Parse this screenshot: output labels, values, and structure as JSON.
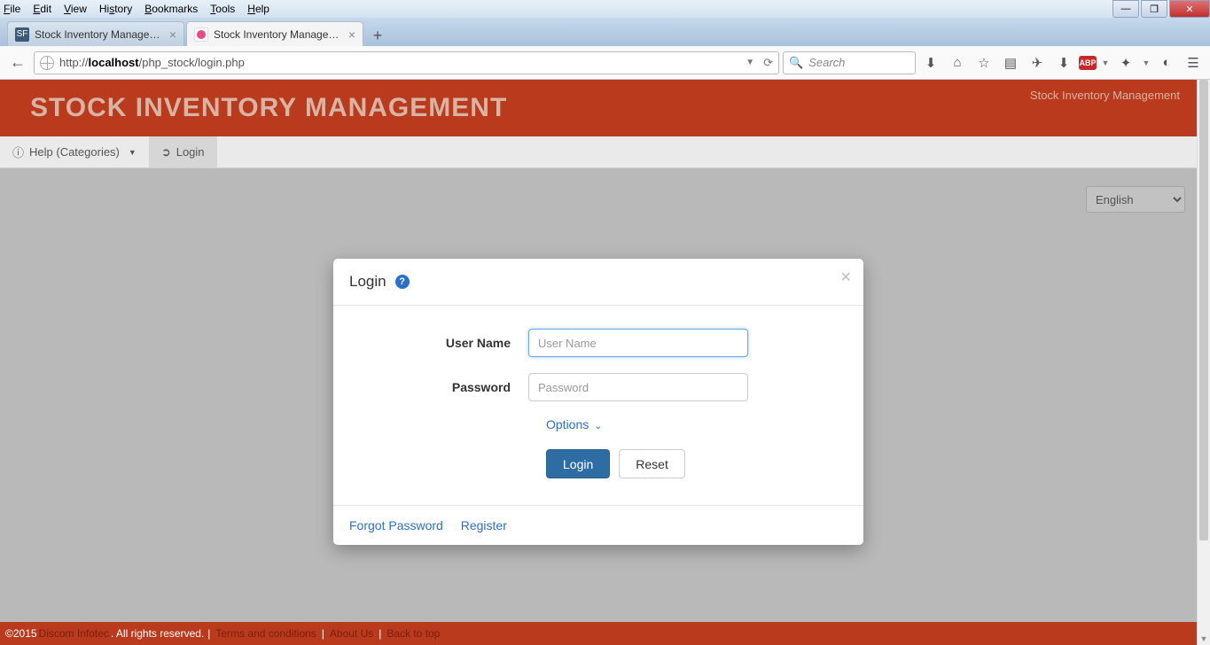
{
  "browser": {
    "menus": {
      "file": "File",
      "edit": "Edit",
      "view": "View",
      "history": "History",
      "bookmarks": "Bookmarks",
      "tools": "Tools",
      "help": "Help"
    },
    "tabs": [
      {
        "label": "Stock Inventory Managem...",
        "active": false
      },
      {
        "label": "Stock Inventory Managem...",
        "active": true
      }
    ],
    "url_prefix": "http://",
    "url_host": "localhost",
    "url_path": "/php_stock/login.php",
    "search_placeholder": "Search"
  },
  "site": {
    "title": "STOCK INVENTORY MANAGEMENT",
    "subtitle": "Stock Inventory Management",
    "nav": {
      "help": "Help (Categories)",
      "login": "Login"
    },
    "language": "English"
  },
  "modal": {
    "title": "Login",
    "username_label": "User Name",
    "username_placeholder": "User Name",
    "password_label": "Password",
    "password_placeholder": "Password",
    "options": "Options",
    "login_btn": "Login",
    "reset_btn": "Reset",
    "forgot": "Forgot Password",
    "register": "Register"
  },
  "footer": {
    "copyright": "©2015 ",
    "company": "Discom Infotec",
    "rights": ". All rights reserved. ",
    "terms": "Terms and conditions",
    "about": "About Us",
    "top": "Back to top"
  }
}
